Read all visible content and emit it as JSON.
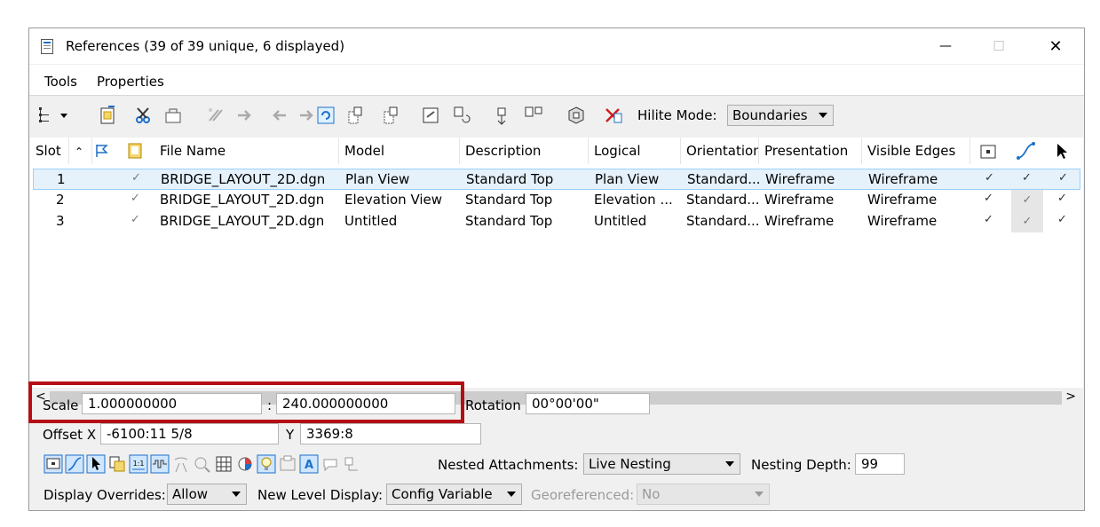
{
  "window": {
    "title": "References (39 of 39 unique, 6 displayed)",
    "controls": {
      "minimize": "—",
      "maximize": "☐",
      "close": "✕"
    }
  },
  "menu": {
    "tools": "Tools",
    "properties": "Properties"
  },
  "toolbar": {
    "hilite_label": "Hilite Mode:",
    "hilite_value": "Boundaries"
  },
  "table": {
    "headers": {
      "slot": "Slot",
      "file_name": "File Name",
      "model": "Model",
      "description": "Description",
      "logical": "Logical",
      "orientation": "Orientation",
      "presentation": "Presentation",
      "visible_edges": "Visible Edges"
    },
    "rows": [
      {
        "slot": "1",
        "check": "✓",
        "file": "BRIDGE_LAYOUT_2D.dgn",
        "model": "Plan View",
        "description": "Standard Top",
        "logical": "Plan View",
        "orientation": "Standard...",
        "presentation": "Wireframe",
        "edges": "Wireframe",
        "c1": "✓",
        "c2": "✓",
        "c3": "✓"
      },
      {
        "slot": "2",
        "check": "✓",
        "file": "BRIDGE_LAYOUT_2D.dgn",
        "model": "Elevation View",
        "description": "Standard Top",
        "logical": "Elevation ...",
        "orientation": "Standard...",
        "presentation": "Wireframe",
        "edges": "Wireframe",
        "c1": "✓",
        "c2": "✓",
        "c3": "✓"
      },
      {
        "slot": "3",
        "check": "✓",
        "file": "BRIDGE_LAYOUT_2D.dgn",
        "model": "Untitled",
        "description": "Standard Top",
        "logical": "Untitled",
        "orientation": "Standard...",
        "presentation": "Wireframe",
        "edges": "Wireframe",
        "c1": "✓",
        "c2": "✓",
        "c3": "✓"
      }
    ]
  },
  "scroll": {
    "left": "<",
    "right": ">"
  },
  "props": {
    "scale_label": "Scale",
    "scale_master": "1.000000000",
    "colon": ":",
    "scale_ref": "240.000000000",
    "rotation_label": "Rotation",
    "rotation_value": "00°00'00\"",
    "offset_label": "Offset X",
    "offset_x": "-6100:11 5/8",
    "y_label": "Y",
    "offset_y": "3369:8",
    "nested_label": "Nested Attachments:",
    "nested_value": "Live Nesting",
    "depth_label": "Nesting Depth:",
    "depth_value": "99",
    "display_overrides_label": "Display Overrides:",
    "display_overrides_value": "Allow",
    "new_level_label": "New Level Display:",
    "new_level_value": "Config Variable",
    "georef_label": "Georeferenced:",
    "georef_value": "No",
    "one_to_one": "1:1"
  },
  "colors": {
    "highlight": "#b50e14",
    "selection": "#e5f1fb",
    "icon_blue": "#1e6fc8"
  }
}
